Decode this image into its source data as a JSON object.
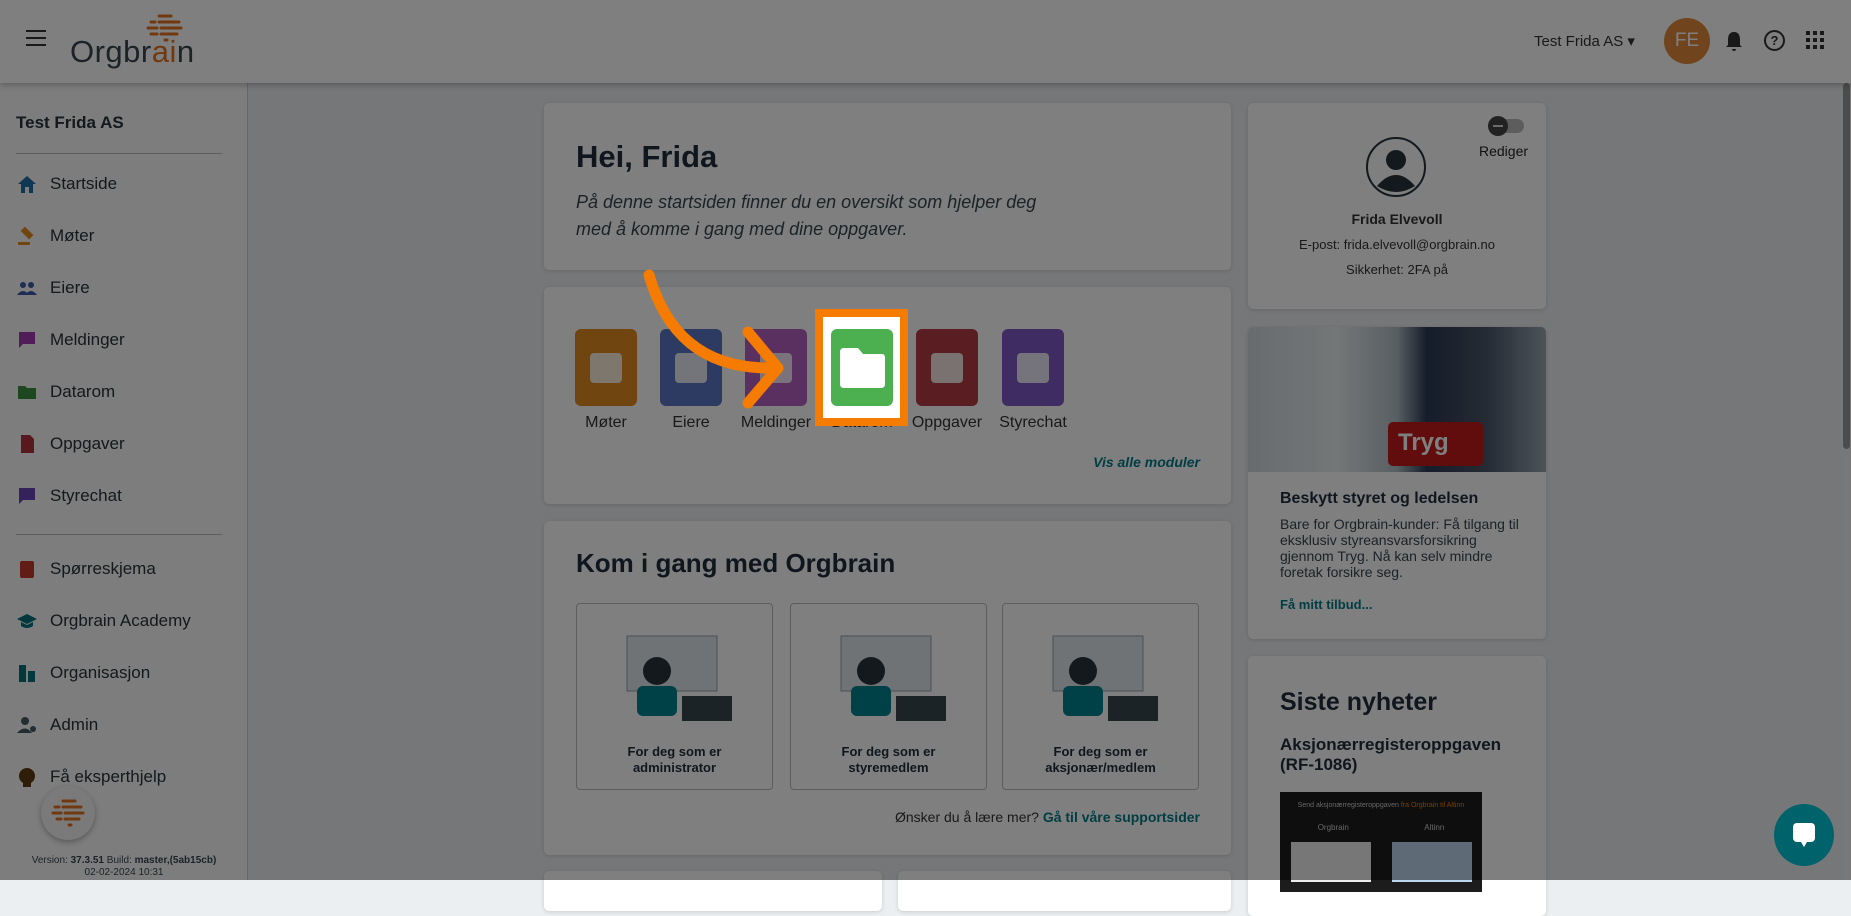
{
  "header": {
    "logo_text_dark": "Orgbr",
    "logo_text_accent": "ai",
    "logo_text_end": "n",
    "company_selector": "Test Frida AS",
    "avatar_initials": "FE"
  },
  "sidebar": {
    "company": "Test Frida AS",
    "items": [
      {
        "label": "Startside",
        "icon": "home-icon",
        "color": "#1e6fa8"
      },
      {
        "label": "Møter",
        "icon": "gavel-icon",
        "color": "#e08a1e"
      },
      {
        "label": "Eiere",
        "icon": "people-icon",
        "color": "#3b5aa6"
      },
      {
        "label": "Meldinger",
        "icon": "message-icon",
        "color": "#a03ab0"
      },
      {
        "label": "Datarom",
        "icon": "folder-icon",
        "color": "#3a8f3e"
      },
      {
        "label": "Oppgaver",
        "icon": "task-icon",
        "color": "#b0303a"
      },
      {
        "label": "Styrechat",
        "icon": "chat-icon",
        "color": "#6a44b8"
      }
    ],
    "items2": [
      {
        "label": "Spørreskjema",
        "icon": "survey-icon",
        "color": "#c0392b"
      },
      {
        "label": "Orgbrain Academy",
        "icon": "school-icon",
        "color": "#00707a"
      },
      {
        "label": "Organisasjon",
        "icon": "organization-icon",
        "color": "#00707a"
      },
      {
        "label": "Admin",
        "icon": "admin-icon",
        "color": "#455a64"
      },
      {
        "label": "Få eksperthjelp",
        "icon": "expert-help-icon",
        "color": "#5d3a12"
      }
    ],
    "version_label": "Version:",
    "version": "37.3.51",
    "build_label": "Build:",
    "build": "master,(5ab15cb)",
    "date": "02-02-2024 10:31"
  },
  "welcome": {
    "title": "Hei, Frida",
    "text_line1": "På denne startsiden finner du en oversikt som hjelper deg",
    "text_line2": "med å komme i gang med dine oppgaver."
  },
  "modules": {
    "items": [
      {
        "label": "Møter",
        "color": "#e08a1e"
      },
      {
        "label": "Eiere",
        "color": "#5a74c4"
      },
      {
        "label": "Meldinger",
        "color": "#b460c0"
      },
      {
        "label": "Datarom",
        "color": "#4caf50"
      },
      {
        "label": "Oppgaver",
        "color": "#b43c44"
      },
      {
        "label": "Styrechat",
        "color": "#7c58c6"
      }
    ],
    "show_all": "Vis alle moduler"
  },
  "getting_started": {
    "title": "Kom i gang med Orgbrain",
    "cards": [
      {
        "line1": "For deg som er",
        "line2": "administrator"
      },
      {
        "line1": "For deg som er",
        "line2": "styremedlem"
      },
      {
        "line1": "For deg som er",
        "line2": "aksjonær/medlem"
      }
    ],
    "footer_text": "Ønsker du å lære mer?",
    "footer_link": "Gå til våre supportsider"
  },
  "profile": {
    "toggle_label": "Rediger",
    "name": "Frida Elvevoll",
    "email": "E-post: frida.elvevoll@orgbrain.no",
    "security": "Sikkerhet: 2FA på"
  },
  "promo": {
    "badge": "Tryg",
    "title": "Beskytt styret og ledelsen",
    "text": "Bare for Orgbrain-kunder: Få tilgang til eksklusiv styreansvarsforsikring gjennom Tryg. Nå kan selv mindre foretak forsikre seg.",
    "link": "Få mitt tilbud..."
  },
  "news": {
    "title": "Siste nyheter",
    "item_title": "Aksjonærregisteroppgaven (RF-1086)",
    "image_text": "Send aksjonærregisteroppgaven",
    "image_text_accent": "fra Orgbrain til Altinn",
    "image_left": "Orgbrain",
    "image_right": "Altinn"
  },
  "colors": {
    "accent": "#f57c00",
    "teal": "#007c89"
  }
}
